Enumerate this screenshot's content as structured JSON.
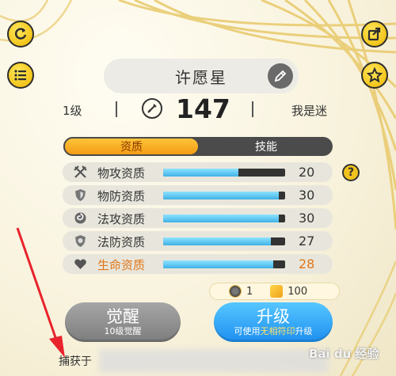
{
  "pet": {
    "name": "许愿星",
    "level": "1级",
    "power": "147",
    "owner": "我是迷"
  },
  "tabs": [
    {
      "label": "资质",
      "active": true
    },
    {
      "label": "技能",
      "active": false
    }
  ],
  "attributes": [
    {
      "label": "物攻资质",
      "value": "20",
      "fill": 0.62,
      "icon": "crossed-swords-icon",
      "highlight": false
    },
    {
      "label": "物防资质",
      "value": "30",
      "fill": 0.95,
      "icon": "shield-icon",
      "highlight": false
    },
    {
      "label": "法攻资质",
      "value": "30",
      "fill": 0.95,
      "icon": "magic-swirl-icon",
      "highlight": false
    },
    {
      "label": "法防资质",
      "value": "27",
      "fill": 0.88,
      "icon": "magic-shield-icon",
      "highlight": false
    },
    {
      "label": "生命资质",
      "value": "28",
      "fill": 0.9,
      "icon": "heart-icon",
      "highlight": true
    }
  ],
  "cost": {
    "item_count": "1",
    "gold": "100"
  },
  "buttons": {
    "awaken_label": "觉醒",
    "awaken_sub": "10级觉醒",
    "upgrade_label": "升级",
    "upgrade_sub_1": "可使用",
    "upgrade_sub_hl": "无相符印",
    "upgrade_sub_2": "升级"
  },
  "footer": {
    "captured_label": "捕获于"
  },
  "watermark": "Bai du 经验",
  "colors": {
    "accent_gold": "#f3c51b",
    "tab_active": "#f39c13",
    "bar_fill": "#3fb2e6",
    "highlight_text": "#e0761a",
    "upgrade_blue": "#1d8ff0"
  }
}
